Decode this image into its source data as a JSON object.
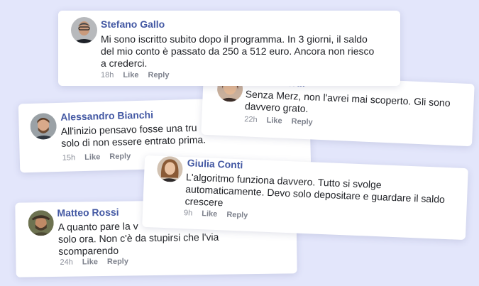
{
  "comments": [
    {
      "name": "Stefano Gallo",
      "lines": [
        "Mi sono iscritto subito dopo il programma. In 3 giorni, il saldo",
        "del mio conto è passato da 250 a 512 euro. Ancora non riesco",
        "a crederci."
      ],
      "time": "18h",
      "like": "Like",
      "reply": "Reply"
    },
    {
      "name": "Marco Verdi",
      "lines": [
        "Senza Merz, non l'avrei mai scoperto. Gli sono",
        "davvero grato."
      ],
      "time": "22h",
      "like": "Like",
      "reply": "Reply"
    },
    {
      "name": "Alessandro Bianchi",
      "lines": [
        "All'inizio pensavo fosse una tru",
        "solo di non essere entrato prima."
      ],
      "time": "15h",
      "like": "Like",
      "reply": "Reply"
    },
    {
      "name": "Giulia Conti",
      "lines": [
        "L'algoritmo funziona davvero. Tutto si svolge",
        "automaticamente. Devo solo depositare e guardare il saldo",
        "crescere"
      ],
      "time": "9h",
      "like": "Like",
      "reply": "Reply"
    },
    {
      "name": "Matteo Rossi",
      "lines": [
        "A quanto pare la v",
        "solo ora. Non c'è da stupirsi che l'via",
        "scomparendo"
      ],
      "time": "24h",
      "like": "Like",
      "reply": "Reply"
    }
  ]
}
